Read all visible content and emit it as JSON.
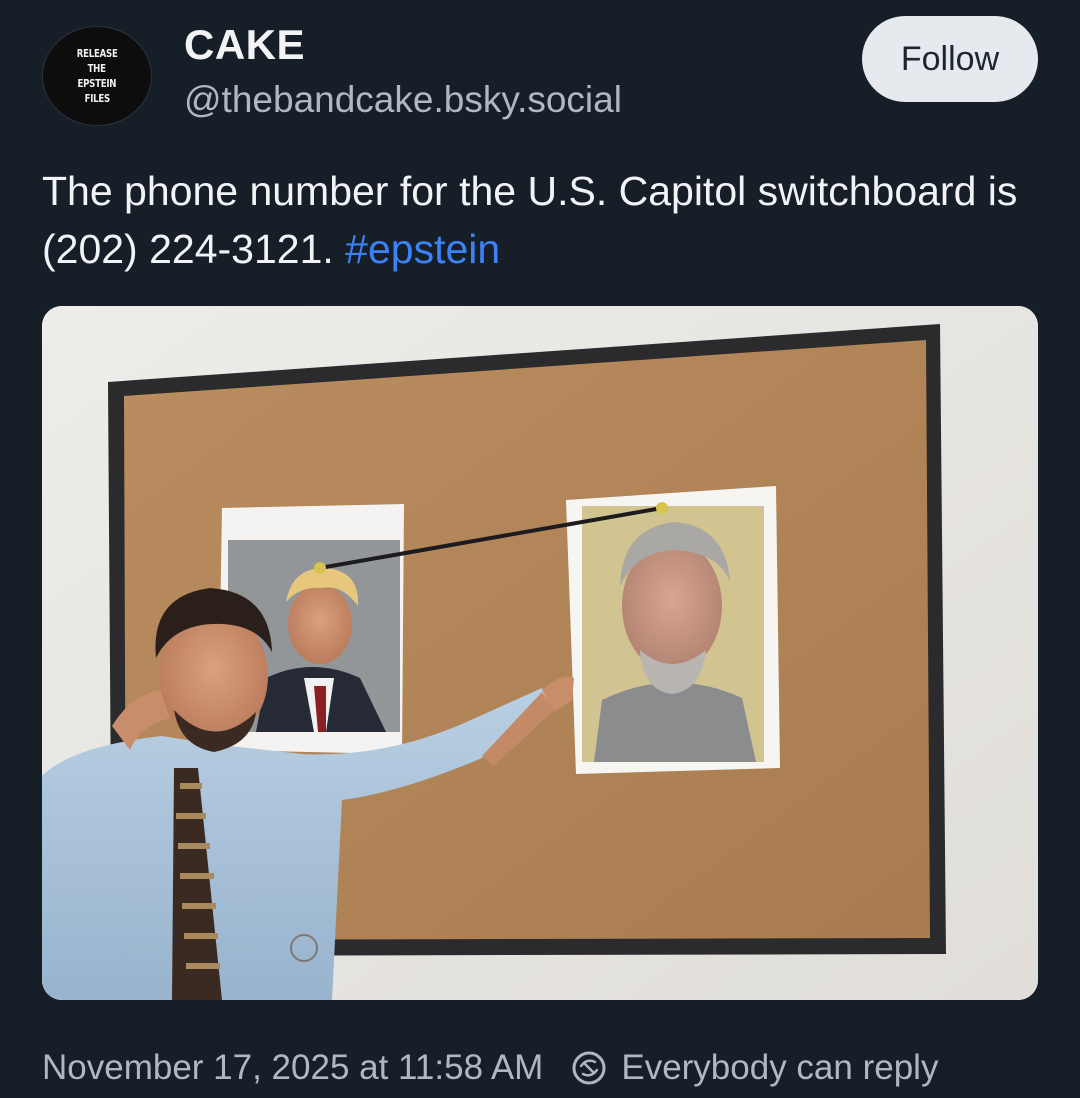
{
  "author": {
    "avatar_lines": [
      "RELEASE",
      "THE",
      "EPSTEIN",
      "FILES"
    ],
    "display_name": "CAKE",
    "handle": "@thebandcake.bsky.social"
  },
  "follow_label": "Follow",
  "post": {
    "text": "The phone number for the U.S. Capitol switchboard is (202) 224-3121.",
    "hashtag": "#epstein"
  },
  "footer": {
    "timestamp": "November 17, 2025 at 11:58 AM",
    "reply_icon": "reply-restriction-icon",
    "reply_setting": "Everybody can reply"
  },
  "colors": {
    "background": "#161e27",
    "hashtag": "#3b82f6",
    "follow_button": "#e6e9ee"
  }
}
